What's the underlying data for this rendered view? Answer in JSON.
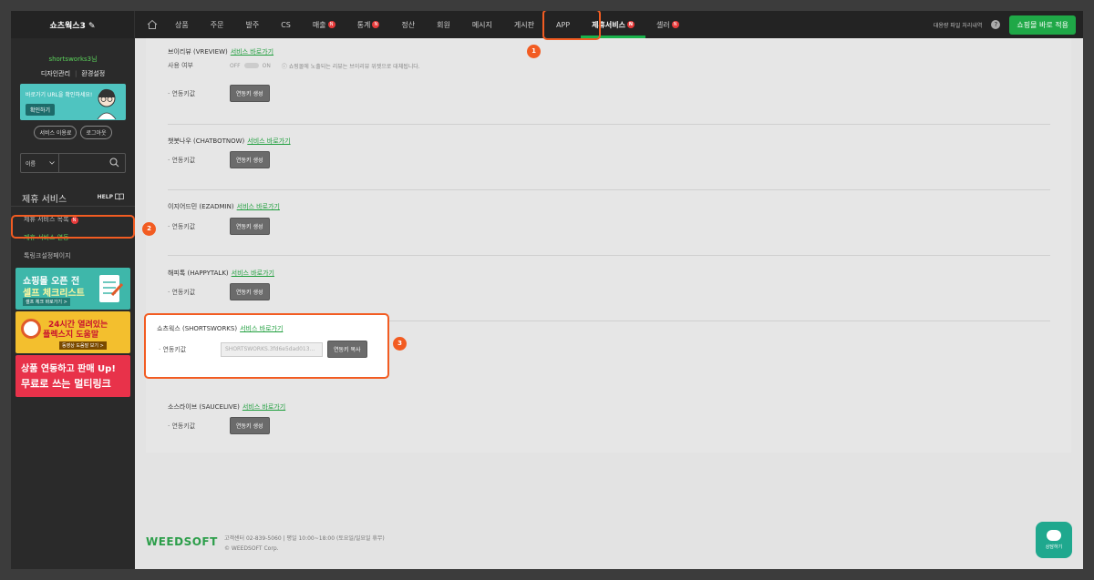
{
  "brand": "쇼츠웍스3 ✎",
  "nav": {
    "items": [
      {
        "label": "상품",
        "badge": ""
      },
      {
        "label": "주문",
        "badge": ""
      },
      {
        "label": "발주",
        "badge": ""
      },
      {
        "label": "CS",
        "badge": ""
      },
      {
        "label": "매출",
        "badge": "N"
      },
      {
        "label": "통계",
        "badge": "N"
      },
      {
        "label": "정산",
        "badge": ""
      },
      {
        "label": "회원",
        "badge": ""
      },
      {
        "label": "메시지",
        "badge": ""
      },
      {
        "label": "게시판",
        "badge": ""
      },
      {
        "label": "APP",
        "badge": ""
      },
      {
        "label": "제휴서비스",
        "badge": "N"
      },
      {
        "label": "셀러",
        "badge": "N"
      }
    ],
    "bulk_label": "대용량 파일 처리내역",
    "help_icon": "?",
    "apply_label": "쇼핑몰 바로 적용"
  },
  "sidebar": {
    "username": "shortsworks3님",
    "link_design": "디자인관리",
    "link_sep": "|",
    "link_env": "환경설정",
    "banner_text": "바로가기 URL을 확인하세요!",
    "banner_btn": "확인하기",
    "service_btn": "서비스 이용료",
    "logout_btn": "로그아웃",
    "search_select": "이름",
    "section_title": "제휴 서비스",
    "help_label": "HELP",
    "items": [
      {
        "label": "제휴 서비스 목록",
        "badge": "N"
      },
      {
        "label": "제휴 서비스 연동",
        "badge": ""
      },
      {
        "label": "톡링크설정페이지",
        "badge": ""
      }
    ],
    "ads": [
      {
        "line1": "쇼핑몰 오픈 전",
        "line2": "셀프 체크리스트",
        "line3": "셀프 체크 바로가기 >"
      },
      {
        "line1": "24시간 열려있는",
        "line2": "플렉스지 도움말",
        "line3": "동영상 도움말 보기 >"
      },
      {
        "line1": "상품 연동하고 판매 Up!",
        "line2": "무료로 쓰는 멀티링크"
      }
    ]
  },
  "services": {
    "link_label": "서비스 바로가기",
    "key_label": "· 연동키값",
    "gen_btn": "연동키 생성",
    "copy_btn": "연동키 복사",
    "use_label": "사용 여부",
    "toggle_off": "OFF",
    "toggle_on": "ON",
    "vreview_note": "ⓘ 쇼핑몰에 노출되는 리뷰는 브이리뷰 위젯으로 대체됩니다.",
    "list": [
      {
        "name": "브이리뷰 (VREVIEW)"
      },
      {
        "name": "챗봇나우 (CHATBOTNOW)"
      },
      {
        "name": "이지어드민 (EZADMIN)"
      },
      {
        "name": "해피톡 (HAPPYTALK)"
      },
      {
        "name": "쇼츠웍스 (SHORTSWORKS)",
        "key_value": "SHORTSWORKS.3fd6e5dad013..."
      },
      {
        "name": "소스라이브 (SAUCELIVE)"
      }
    ]
  },
  "steps": [
    "1",
    "2",
    "3"
  ],
  "footer": {
    "logo": "WEEDSOFT",
    "line1": "고객센터 02-839-5060  |  평일 10:00~18:00 (토요일/일요일 휴무)",
    "line2": "© WEEDSOFT Corp."
  },
  "chat_label": "상담하기",
  "colors": {
    "accent": "#1fa847",
    "highlight": "#f25c22",
    "badge": "#e83b3b"
  }
}
